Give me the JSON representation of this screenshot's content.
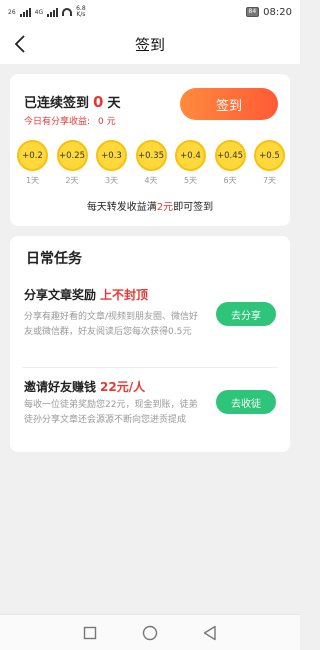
{
  "status_bar": {
    "sim1": "26",
    "sim2": "4G",
    "speed_top": "6.8",
    "speed_unit": "K/s",
    "battery": "84",
    "time": "08:20"
  },
  "nav": {
    "title": "签到"
  },
  "checkin": {
    "streak_prefix": "已连续签到",
    "streak_days": "0",
    "streak_suffix": "天",
    "today_label": "今日有分享收益:",
    "today_value": "0 元",
    "sign_button": "签到",
    "rewards": [
      {
        "amount": "+0.2",
        "day": "1天"
      },
      {
        "amount": "+0.25",
        "day": "2天"
      },
      {
        "amount": "+0.3",
        "day": "3天"
      },
      {
        "amount": "+0.35",
        "day": "4天"
      },
      {
        "amount": "+0.4",
        "day": "5天"
      },
      {
        "amount": "+0.45",
        "day": "6天"
      },
      {
        "amount": "+0.5",
        "day": "7天"
      }
    ],
    "rule_prefix": "每天转发收益满",
    "rule_amount": "2元",
    "rule_suffix": "即可签到"
  },
  "daily": {
    "title": "日常任务",
    "tasks": [
      {
        "title": "分享文章奖励",
        "highlight": "上不封顶",
        "desc": "分享有趣好看的文章/视频到朋友圈、微信好友或微信群，好友阅读后您每次获得0.5元",
        "button": "去分享"
      },
      {
        "title": "邀请好友赚钱",
        "highlight": "22元/人",
        "desc": "每收一位徒弟奖励您22元，现金到账，徒弟徒孙分享文章还会源源不断向您进贡提成",
        "button": "去收徒"
      }
    ]
  },
  "colors": {
    "accent_red": "#e53935",
    "sign_gradient_start": "#ff8a3d",
    "sign_gradient_end": "#ff5a36",
    "coin": "#ffd93b",
    "green": "#2ec47a"
  }
}
